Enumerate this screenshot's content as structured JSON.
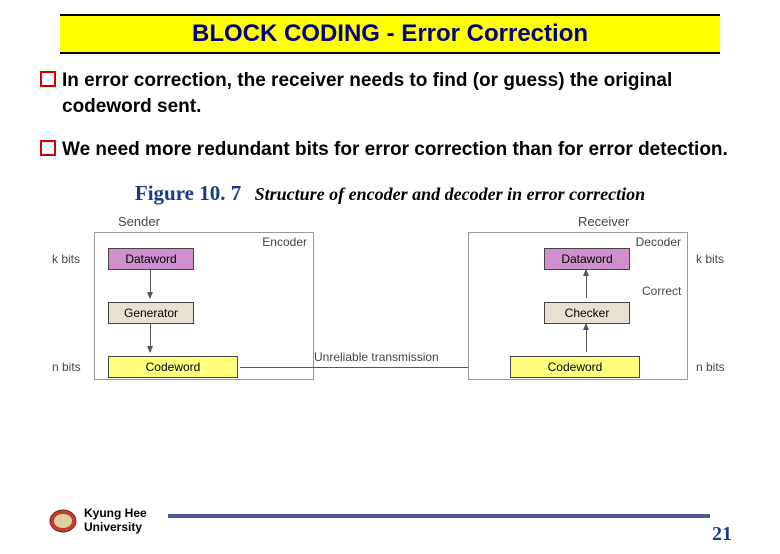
{
  "title": "BLOCK CODING - Error Correction",
  "bullets": {
    "b1": "In error correction, the receiver needs to find (or guess) the original codeword sent.",
    "b2": "We need more redundant bits for error correction than for error detection."
  },
  "figure": {
    "num": "Figure 10. 7",
    "desc": "Structure of encoder and decoder in error correction"
  },
  "diagram": {
    "sender": "Sender",
    "receiver": "Receiver",
    "encoder": "Encoder",
    "decoder": "Decoder",
    "dataword": "Dataword",
    "generator": "Generator",
    "checker": "Checker",
    "correct": "Correct",
    "codeword": "Codeword",
    "kbits": "k bits",
    "nbits": "n bits",
    "unreliable": "Unreliable transmission"
  },
  "footer": {
    "uni1": "Kyung Hee",
    "uni2": "University",
    "page": "21"
  }
}
